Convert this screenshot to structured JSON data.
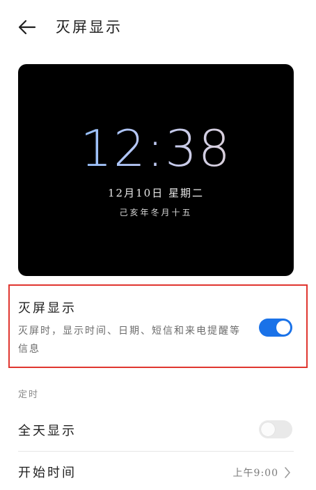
{
  "header": {
    "title": "灭屏显示",
    "back_icon": "arrow-left-icon"
  },
  "preview": {
    "time": "12:38",
    "date": "12月10日 星期二",
    "lunar": "己亥年冬月十五",
    "background": "#000000"
  },
  "always_on": {
    "title": "灭屏显示",
    "description": "灭屏时，显示时间、日期、短信和来电提醒等信息",
    "enabled": true,
    "accent_color": "#1a72e8"
  },
  "schedule": {
    "section_label": "定时",
    "all_day_label": "全天显示",
    "all_day_enabled": false,
    "start_time_label": "开始时间",
    "start_time_value": "上午9:00"
  }
}
